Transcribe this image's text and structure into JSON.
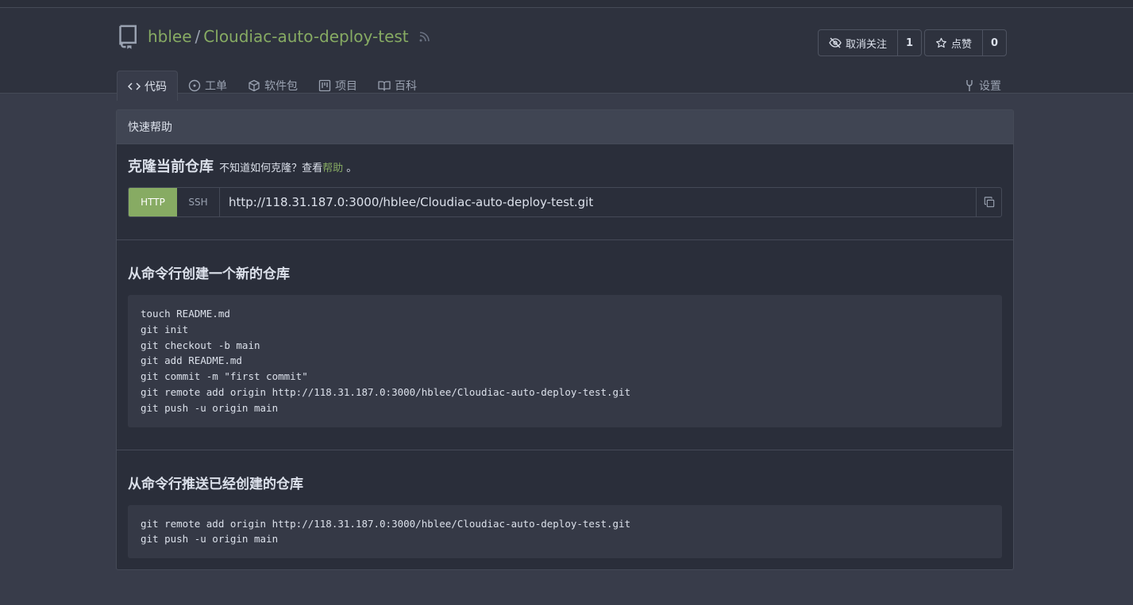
{
  "repo": {
    "owner": "hblee",
    "separator": "/",
    "name": "Cloudiac-auto-deploy-test"
  },
  "watch": {
    "label": "取消关注",
    "count": "1"
  },
  "star": {
    "label": "点赞",
    "count": "0"
  },
  "tabs": [
    {
      "label": "代码",
      "icon": "code-icon"
    },
    {
      "label": "工单",
      "icon": "issue-icon"
    },
    {
      "label": "软件包",
      "icon": "package-icon"
    },
    {
      "label": "项目",
      "icon": "project-icon"
    },
    {
      "label": "百科",
      "icon": "book-icon"
    }
  ],
  "settings": {
    "label": "设置",
    "icon": "tools-icon"
  },
  "quick_help": {
    "header": "快速帮助",
    "clone_title": "克隆当前仓库",
    "clone_note": "不知道如何克隆？查看",
    "clone_help_link": "帮助",
    "clone_note_end": "。",
    "http_label": "HTTP",
    "ssh_label": "SSH",
    "clone_url": "http://118.31.187.0:3000/hblee/Cloudiac-auto-deploy-test.git"
  },
  "new_repo": {
    "title": "从命令行创建一个新的仓库",
    "lines": [
      "touch README.md",
      "git init",
      "git checkout -b main",
      "git add README.md",
      "git commit -m \"first commit\"",
      "git remote add origin http://118.31.187.0:3000/hblee/Cloudiac-auto-deploy-test.git",
      "git push -u origin main"
    ]
  },
  "push_existing": {
    "title": "从命令行推送已经创建的仓库",
    "lines": [
      "git remote add origin http://118.31.187.0:3000/hblee/Cloudiac-auto-deploy-test.git",
      "git push -u origin main"
    ]
  },
  "colors": {
    "accent": "#87ab63",
    "background": "#383c4a",
    "header_bg": "#2e323e"
  }
}
